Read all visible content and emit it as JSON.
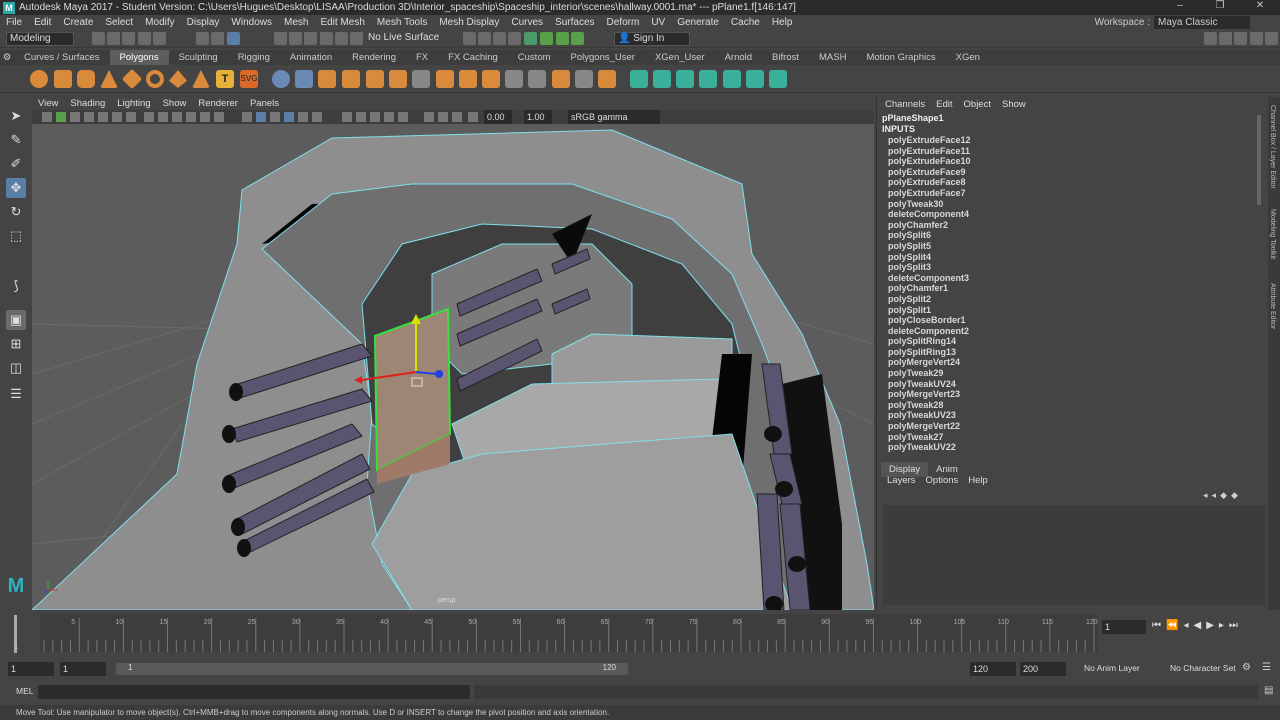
{
  "app": {
    "title": "Autodesk Maya 2017 - Student Version: C:\\Users\\Hugues\\Desktop\\LISAA\\Production 3D\\Interior_spaceship\\Spaceship_interior\\scenes\\hallway.0001.ma*   ---   pPlane1.f[146:147]",
    "window_controls": [
      "–",
      "❐",
      "✕"
    ]
  },
  "menubar": {
    "items": [
      "File",
      "Edit",
      "Create",
      "Select",
      "Modify",
      "Display",
      "Windows",
      "Mesh",
      "Edit Mesh",
      "Mesh Tools",
      "Mesh Display",
      "Curves",
      "Surfaces",
      "Deform",
      "UV",
      "Generate",
      "Cache",
      "Help"
    ],
    "workspace_label": "Workspace :",
    "workspace_value": "Maya Classic"
  },
  "statusline": {
    "mode": "Modeling",
    "live_surface": "No Live Surface",
    "sign_in": "Sign In"
  },
  "shelf": {
    "tabs": [
      "Curves / Surfaces",
      "Polygons",
      "Sculpting",
      "Rigging",
      "Animation",
      "Rendering",
      "FX",
      "FX Caching",
      "Custom",
      "Polygons_User",
      "XGen_User",
      "Arnold",
      "Bifrost",
      "MASH",
      "Motion Graphics",
      "XGen"
    ],
    "active_tab": "Polygons"
  },
  "viewport": {
    "menu": [
      "View",
      "Shading",
      "Lighting",
      "Show",
      "Renderer",
      "Panels"
    ],
    "field_a": "0.00",
    "field_b": "1.00",
    "color_space": "sRGB gamma",
    "camera_label": "persp"
  },
  "channel_box": {
    "menu": [
      "Channels",
      "Edit",
      "Object",
      "Show"
    ],
    "object_name": "pPlaneShape1",
    "inputs_label": "INPUTS",
    "inputs": [
      "polyExtrudeFace12",
      "polyExtrudeFace11",
      "polyExtrudeFace10",
      "polyExtrudeFace9",
      "polyExtrudeFace8",
      "polyExtrudeFace7",
      "polyTweak30",
      "deleteComponent4",
      "polyChamfer2",
      "polySplit6",
      "polySplit5",
      "polySplit4",
      "polySplit3",
      "deleteComponent3",
      "polyChamfer1",
      "polySplit2",
      "polySplit1",
      "polyCloseBorder1",
      "deleteComponent2",
      "polySplitRing14",
      "polySplitRing13",
      "polyMergeVert24",
      "polyTweak29",
      "polyTweakUV24",
      "polyMergeVert23",
      "polyTweak28",
      "polyTweakUV23",
      "polyMergeVert22",
      "polyTweak27",
      "polyTweakUV22"
    ],
    "side_tabs": [
      "Channel Box / Layer Editor",
      "Modeling Toolkit",
      "Attribute Editor"
    ]
  },
  "layer_editor": {
    "tabs": [
      "Display",
      "Anim"
    ],
    "active_tab": "Display",
    "menu": [
      "Layers",
      "Options",
      "Help"
    ]
  },
  "timeline": {
    "ticks": [
      "5",
      "10",
      "15",
      "20",
      "25",
      "30",
      "35",
      "40",
      "45",
      "50",
      "55",
      "60",
      "65",
      "70",
      "75",
      "80",
      "85",
      "90",
      "95",
      "100",
      "105",
      "110",
      "115",
      "120"
    ],
    "current_frame": "1",
    "tick_start": "1"
  },
  "range": {
    "start": "1",
    "playback_start": "1",
    "range_start_label": "1",
    "range_end_label": "120",
    "playback_end": "120",
    "end": "200",
    "anim_layer": "No Anim Layer",
    "char_set": "No Character Set"
  },
  "cmdline": {
    "label": "MEL"
  },
  "helpline": {
    "text": "Move Tool: Use manipulator to move object(s). Ctrl+MMB+drag to move components along normals. Use D or INSERT to change the pivot position and axis orientation."
  }
}
